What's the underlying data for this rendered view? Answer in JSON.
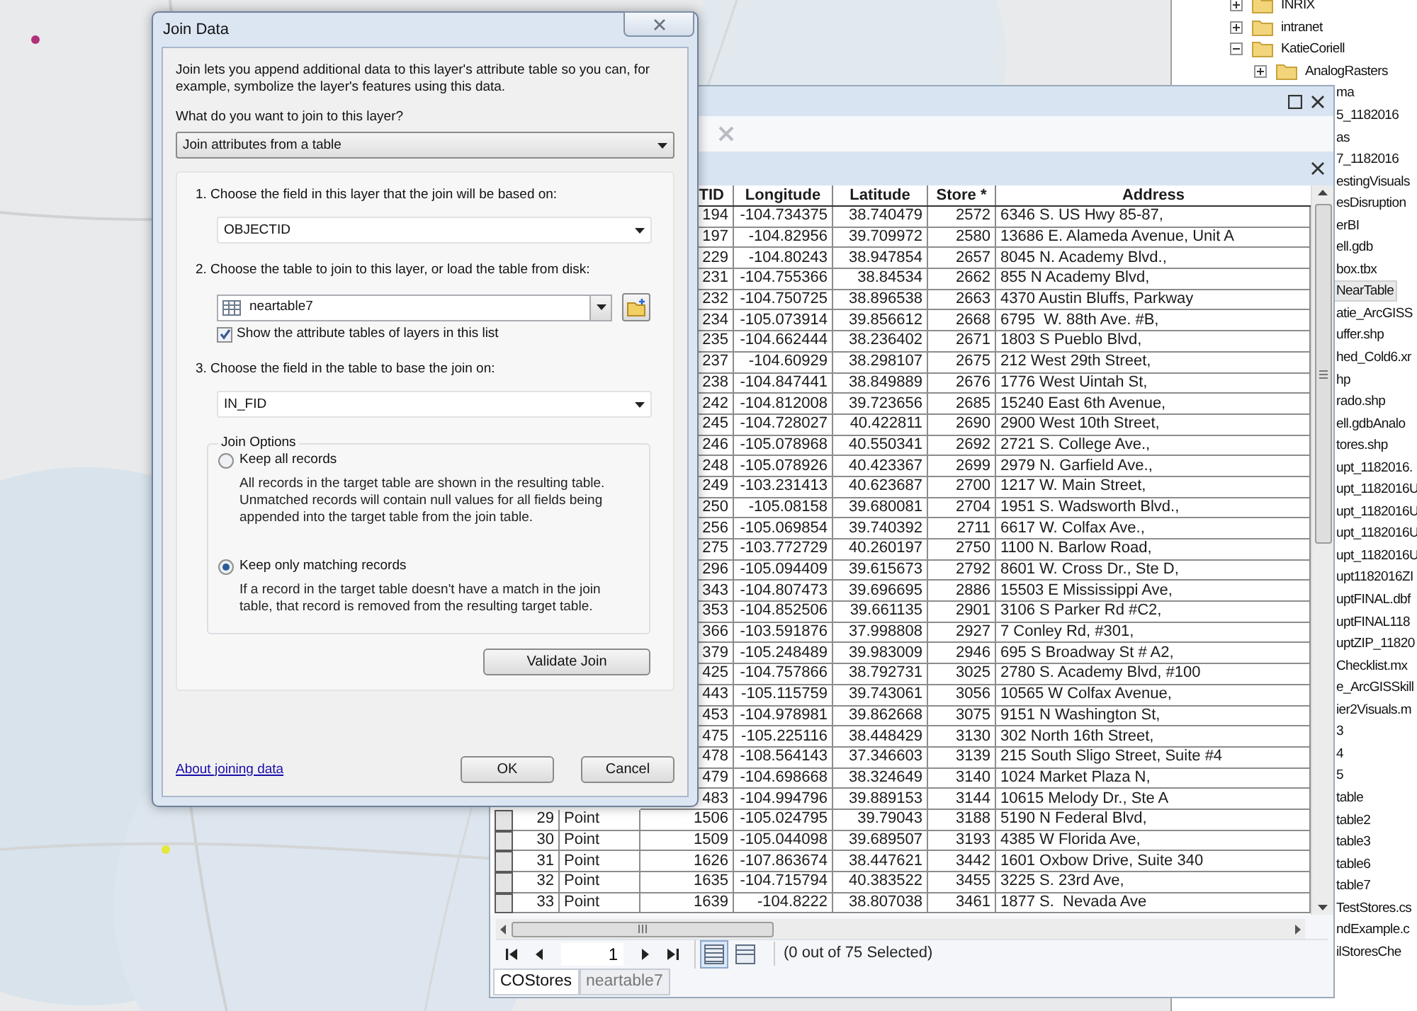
{
  "catalog_tree": [
    {
      "label": "INRIX",
      "kind": "folder",
      "expanded": false,
      "selected": false
    },
    {
      "label": "intranet",
      "kind": "folder",
      "expanded": false,
      "selected": false
    },
    {
      "label": "KatieCoriell",
      "kind": "folder",
      "expanded": true,
      "selected": false,
      "children": [
        {
          "label": "AnalogRasters",
          "kind": "folder",
          "expanded": false,
          "selected": false
        },
        {
          "label": "ma",
          "kind": "item",
          "selected": false
        },
        {
          "label": "5_1182016",
          "kind": "item",
          "selected": false
        },
        {
          "label": "as",
          "kind": "item",
          "selected": false
        },
        {
          "label": "7_1182016",
          "kind": "item",
          "selected": false
        },
        {
          "label": "estingVisuals",
          "kind": "item",
          "selected": false
        },
        {
          "label": "esDisruption",
          "kind": "item",
          "selected": false
        },
        {
          "label": "erBI",
          "kind": "item",
          "selected": false
        },
        {
          "label": "ell.gdb",
          "kind": "item",
          "selected": false
        },
        {
          "label": "box.tbx",
          "kind": "item",
          "selected": false
        },
        {
          "label": "NearTable",
          "kind": "item",
          "selected": true
        },
        {
          "label": "atie_ArcGISS",
          "kind": "item",
          "selected": false
        },
        {
          "label": "uffer.shp",
          "kind": "item",
          "selected": false
        },
        {
          "label": "hed_Cold6.xr",
          "kind": "item",
          "selected": false
        },
        {
          "label": "hp",
          "kind": "item",
          "selected": false
        },
        {
          "label": "rado.shp",
          "kind": "item",
          "selected": false
        },
        {
          "label": "ell.gdbAnalo",
          "kind": "item",
          "selected": false
        },
        {
          "label": "tores.shp",
          "kind": "item",
          "selected": false
        },
        {
          "label": "upt_1182016.",
          "kind": "item",
          "selected": false
        },
        {
          "label": "upt_1182016U",
          "kind": "item",
          "selected": false
        },
        {
          "label": "upt_1182016U",
          "kind": "item",
          "selected": false
        },
        {
          "label": "upt_1182016U",
          "kind": "item",
          "selected": false
        },
        {
          "label": "upt_1182016U",
          "kind": "item",
          "selected": false
        },
        {
          "label": "upt1182016ZI",
          "kind": "item",
          "selected": false
        },
        {
          "label": "uptFINAL.dbf",
          "kind": "item",
          "selected": false
        },
        {
          "label": "uptFINAL118",
          "kind": "item",
          "selected": false
        },
        {
          "label": "uptZIP_11820",
          "kind": "item",
          "selected": false
        },
        {
          "label": "Checklist.mx",
          "kind": "item",
          "selected": false
        },
        {
          "label": "e_ArcGISSkill",
          "kind": "item",
          "selected": false
        },
        {
          "label": "ier2Visuals.m",
          "kind": "item",
          "selected": false
        },
        {
          "label": "3",
          "kind": "item",
          "selected": false
        },
        {
          "label": "4",
          "kind": "item",
          "selected": false
        },
        {
          "label": "5",
          "kind": "item",
          "selected": false
        },
        {
          "label": "table",
          "kind": "item",
          "selected": false
        },
        {
          "label": "table2",
          "kind": "item",
          "selected": false
        },
        {
          "label": "table3",
          "kind": "item",
          "selected": false
        },
        {
          "label": "table6",
          "kind": "item",
          "selected": false
        },
        {
          "label": "table7",
          "kind": "item",
          "selected": false
        },
        {
          "label": "TestStores.cs",
          "kind": "item",
          "selected": false
        },
        {
          "label": "ndExample.c",
          "kind": "item",
          "selected": false
        },
        {
          "label": "ilStoresChe",
          "kind": "item",
          "selected": false
        }
      ]
    }
  ],
  "table": {
    "columns": [
      "TID",
      "Longitude",
      "Latitude",
      "Store *",
      "Address"
    ],
    "rows": [
      {
        "id": "194",
        "longitude": "-104.734375",
        "latitude": "38.740479",
        "store": "2572",
        "address": "6346 S. US Hwy 85-87,"
      },
      {
        "id": "197",
        "longitude": "-104.82956",
        "latitude": "39.709972",
        "store": "2580",
        "address": "13686 E. Alameda Avenue, Unit A"
      },
      {
        "id": "229",
        "longitude": "-104.80243",
        "latitude": "38.947854",
        "store": "2657",
        "address": "8045 N. Academy Blvd.,"
      },
      {
        "id": "231",
        "longitude": "-104.755366",
        "latitude": "38.84534",
        "store": "2662",
        "address": "855 N Academy Blvd,"
      },
      {
        "id": "232",
        "longitude": "-104.750725",
        "latitude": "38.896538",
        "store": "2663",
        "address": "4370 Austin Bluffs, Parkway"
      },
      {
        "id": "234",
        "longitude": "-105.073914",
        "latitude": "39.856612",
        "store": "2668",
        "address": "6795  W. 88th Ave. #B,"
      },
      {
        "id": "235",
        "longitude": "-104.662444",
        "latitude": "38.236402",
        "store": "2671",
        "address": "1803 S Pueblo Blvd,"
      },
      {
        "id": "237",
        "longitude": "-104.60929",
        "latitude": "38.298107",
        "store": "2675",
        "address": "212 West 29th Street,"
      },
      {
        "id": "238",
        "longitude": "-104.847441",
        "latitude": "38.849889",
        "store": "2676",
        "address": "1776 West Uintah St,"
      },
      {
        "id": "242",
        "longitude": "-104.812008",
        "latitude": "39.723656",
        "store": "2685",
        "address": "15240 East 6th Avenue,"
      },
      {
        "id": "245",
        "longitude": "-104.728027",
        "latitude": "40.422811",
        "store": "2690",
        "address": "2900 West 10th Street,"
      },
      {
        "id": "246",
        "longitude": "-105.078968",
        "latitude": "40.550341",
        "store": "2692",
        "address": "2721 S. College Ave.,"
      },
      {
        "id": "248",
        "longitude": "-105.078926",
        "latitude": "40.423367",
        "store": "2699",
        "address": "2979 N. Garfield Ave.,"
      },
      {
        "id": "249",
        "longitude": "-103.231413",
        "latitude": "40.623687",
        "store": "2700",
        "address": "1217 W. Main Street,"
      },
      {
        "id": "250",
        "longitude": "-105.08158",
        "latitude": "39.680081",
        "store": "2704",
        "address": "1951 S. Wadsworth Blvd.,"
      },
      {
        "id": "256",
        "longitude": "-105.069854",
        "latitude": "39.740392",
        "store": "2711",
        "address": "6617 W. Colfax Ave.,"
      },
      {
        "id": "275",
        "longitude": "-103.772729",
        "latitude": "40.260197",
        "store": "2750",
        "address": "1100 N. Barlow Road,"
      },
      {
        "id": "296",
        "longitude": "-105.094409",
        "latitude": "39.615673",
        "store": "2792",
        "address": "8601 W. Cross Dr., Ste D,"
      },
      {
        "id": "343",
        "longitude": "-104.807473",
        "latitude": "39.696695",
        "store": "2886",
        "address": "15503 E Mississippi Ave,"
      },
      {
        "id": "353",
        "longitude": "-104.852506",
        "latitude": "39.661135",
        "store": "2901",
        "address": "3106 S Parker Rd #C2,"
      },
      {
        "id": "366",
        "longitude": "-103.591876",
        "latitude": "37.998808",
        "store": "2927",
        "address": "7 Conley Rd, #301,"
      },
      {
        "id": "379",
        "longitude": "-105.248489",
        "latitude": "39.983009",
        "store": "2946",
        "address": "695 S Broadway St # A2,"
      },
      {
        "id": "425",
        "longitude": "-104.757866",
        "latitude": "38.792731",
        "store": "3025",
        "address": "2780 S. Academy Blvd, #100"
      },
      {
        "id": "443",
        "longitude": "-105.115759",
        "latitude": "39.743061",
        "store": "3056",
        "address": "10565 W Colfax Avenue,"
      },
      {
        "id": "453",
        "longitude": "-104.978981",
        "latitude": "39.862668",
        "store": "3075",
        "address": "9151 N Washington St,"
      },
      {
        "id": "475",
        "longitude": "-105.225116",
        "latitude": "38.448429",
        "store": "3130",
        "address": "302 North 16th Street,"
      },
      {
        "id": "478",
        "longitude": "-108.564143",
        "latitude": "37.346603",
        "store": "3139",
        "address": "215 South Sligo Street, Suite #4"
      },
      {
        "id": "479",
        "longitude": "-104.698668",
        "latitude": "38.324649",
        "store": "3140",
        "address": "1024 Market Plaza N,"
      },
      {
        "id": "483",
        "longitude": "-104.994796",
        "latitude": "39.889153",
        "store": "3144",
        "address": "10615 Melody Dr., Ste A"
      },
      {
        "oid": "29",
        "shape": "Point",
        "id": "1506",
        "longitude": "-105.024795",
        "latitude": "39.79043",
        "store": "3188",
        "address": "5190 N Federal Blvd,"
      },
      {
        "oid": "30",
        "shape": "Point",
        "id": "1509",
        "longitude": "-105.044098",
        "latitude": "39.689507",
        "store": "3193",
        "address": "4385 W Florida Ave,"
      },
      {
        "oid": "31",
        "shape": "Point",
        "id": "1626",
        "longitude": "-107.863674",
        "latitude": "38.447621",
        "store": "3442",
        "address": "1601 Oxbow Drive, Suite 340"
      },
      {
        "oid": "32",
        "shape": "Point",
        "id": "1635",
        "longitude": "-104.715794",
        "latitude": "40.383522",
        "store": "3455",
        "address": "3225 S. 23rd Ave,"
      },
      {
        "oid": "33",
        "shape": "Point",
        "id": "1639",
        "longitude": "-104.8222",
        "latitude": "38.807038",
        "store": "3461",
        "address": "1877 S.  Nevada Ave"
      }
    ],
    "record": "1",
    "view_buttons": [
      {
        "kind": "all",
        "selected": true
      },
      {
        "kind": "selected",
        "selected": false
      }
    ],
    "status": "(0 out of 75 Selected)",
    "tabs": [
      {
        "label": "COStores",
        "selected": true
      },
      {
        "label": "neartable7",
        "selected": false
      }
    ]
  },
  "dialog": {
    "title": "Join Data",
    "intro": "Join lets you append additional data to this layer's attribute table so you can, for example, symbolize the layer's features using this data.",
    "question": "What do you want to join to this layer?",
    "join_type": "Join attributes from a table",
    "steps": [
      {
        "kind": "field",
        "label": "1.  Choose the field in this layer that the join will be based on:",
        "value": "OBJECTID"
      },
      {
        "kind": "table",
        "label": "2.  Choose the table to join to this layer, or load the table from disk:",
        "value": "neartable7",
        "checkbox": {
          "label": "Show the attribute tables of layers in this list",
          "checked": true
        }
      },
      {
        "kind": "field",
        "label": "3.  Choose the field in the table to base the join on:",
        "value": "IN_FID"
      }
    ],
    "options_title": "Join Options",
    "options": [
      {
        "label": "Keep all records",
        "description": "All records in the target table are shown in the resulting table. Unmatched records will contain null values for all fields being appended into the target table from the join table.",
        "selected": false
      },
      {
        "label": "Keep only matching records",
        "description": "If a record in the target table doesn't have a match in the join table, that record is removed from the resulting target table.",
        "selected": true
      }
    ],
    "validate_button": "Validate Join",
    "link": "About joining data",
    "buttons": [
      "OK",
      "Cancel"
    ]
  }
}
